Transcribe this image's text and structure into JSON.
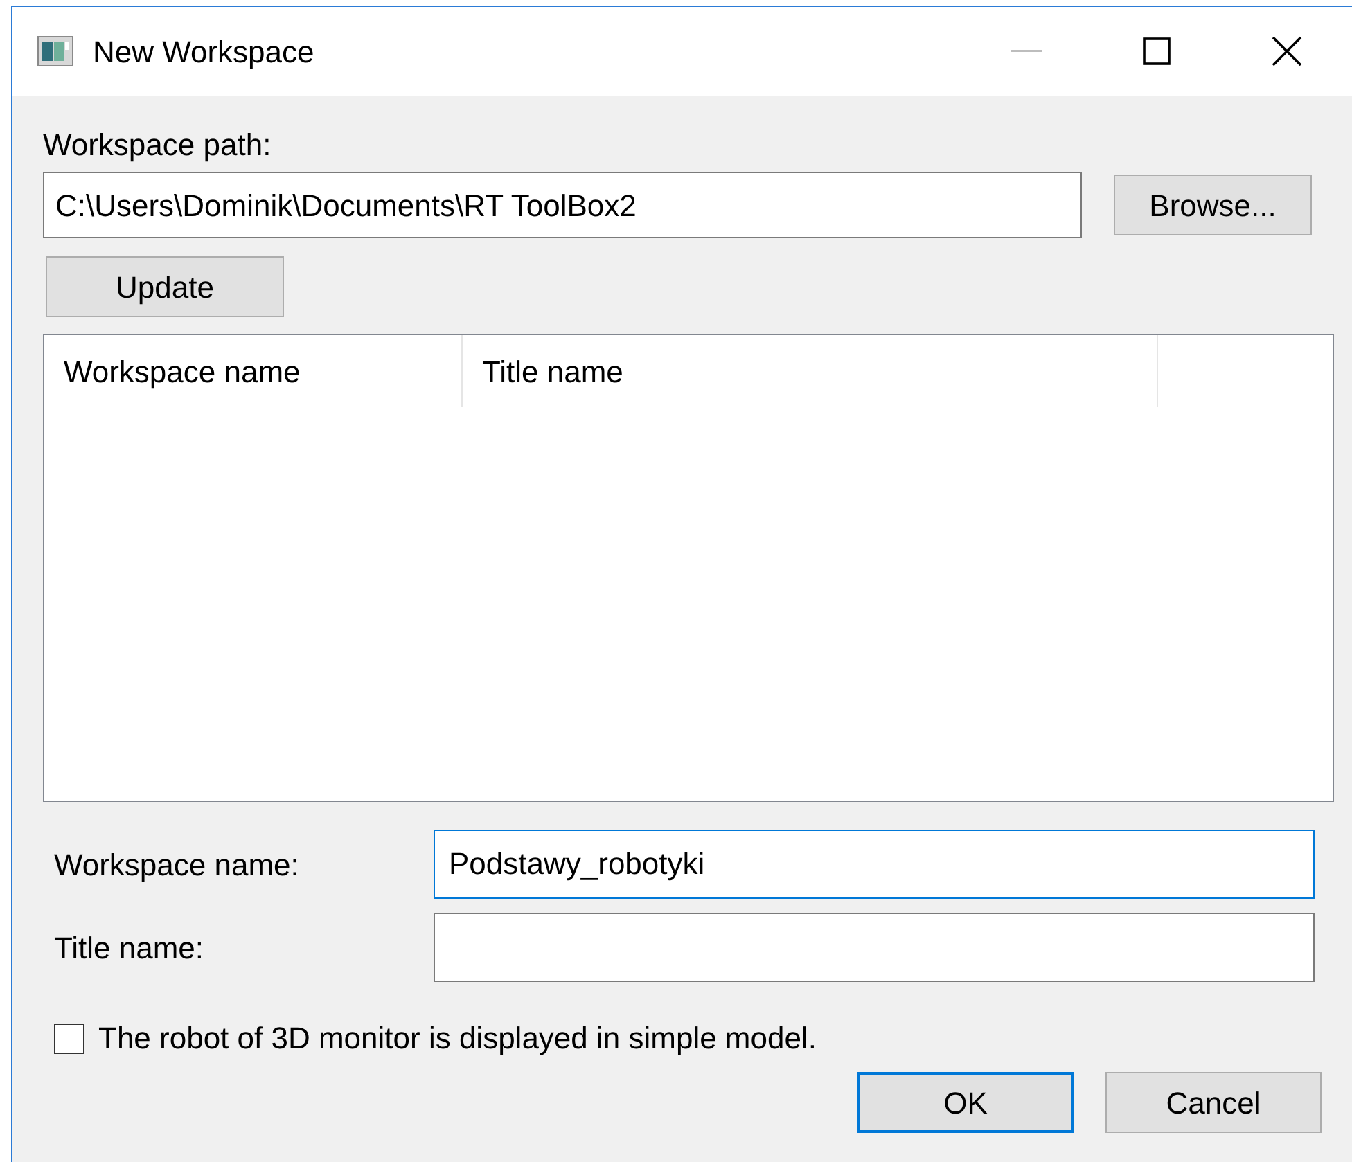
{
  "window": {
    "title": "New Workspace"
  },
  "path": {
    "label": "Workspace path:",
    "value": "C:\\Users\\Dominik\\Documents\\RT ToolBox2",
    "browse_button": "Browse..."
  },
  "update_button": "Update",
  "list": {
    "columns": [
      "Workspace name",
      "Title name"
    ]
  },
  "fields": [
    {
      "label": "Workspace name:",
      "value": "Podstawy_robotyki",
      "focused": true
    },
    {
      "label": "Title name:",
      "focused": false
    }
  ],
  "checkbox": {
    "label": "The robot of 3D monitor is displayed in simple model.",
    "checked": false
  },
  "buttons": [
    {
      "label": "OK",
      "default": true
    },
    {
      "label": "Cancel",
      "default": false
    }
  ]
}
